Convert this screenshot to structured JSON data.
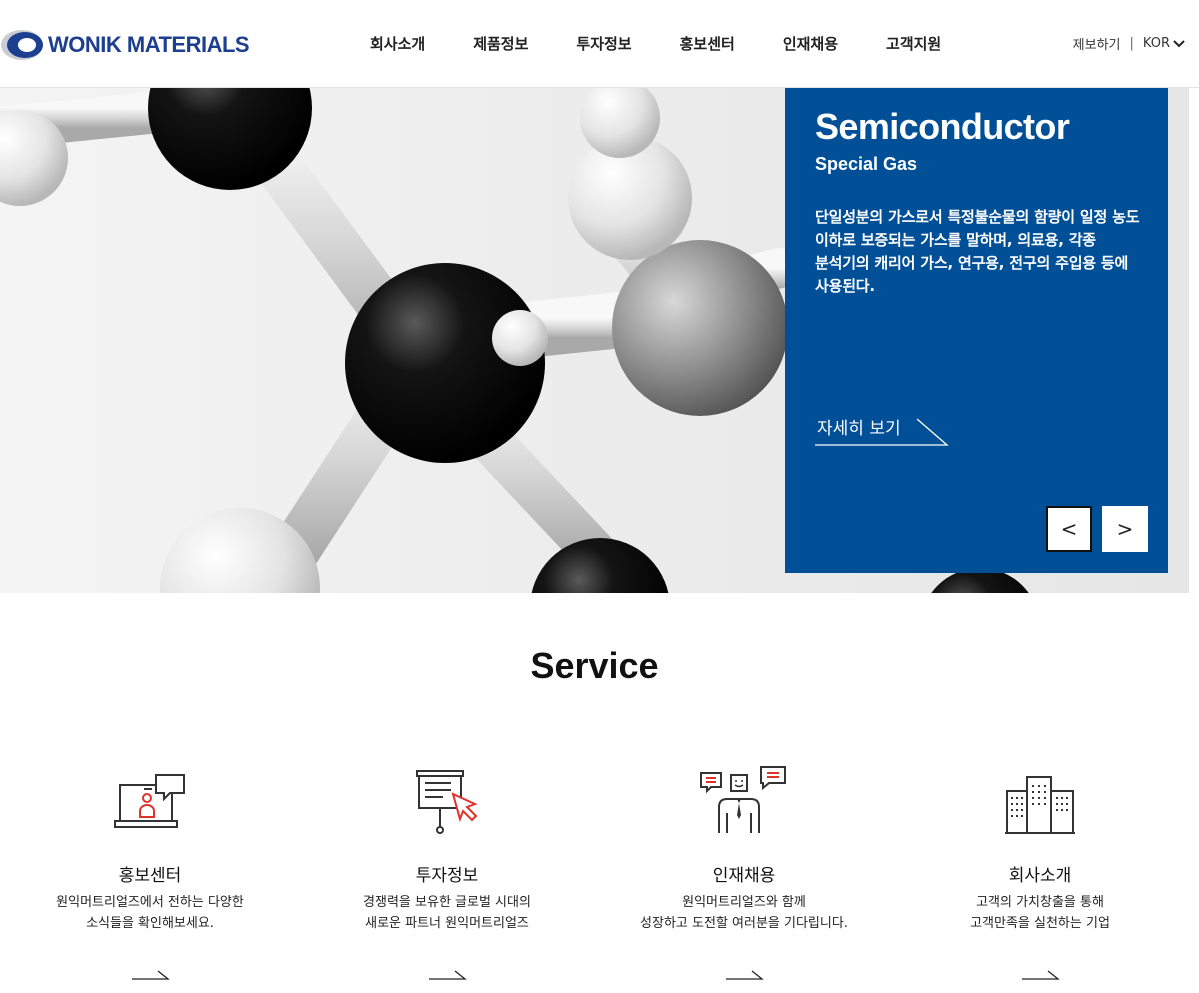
{
  "header": {
    "logo_text": "WONIK MATERIALS",
    "nav": [
      "회사소개",
      "제품정보",
      "투자정보",
      "홍보센터",
      "인재채용",
      "고객지원"
    ],
    "util_report": "제보하기",
    "util_sep": "|",
    "util_lang": "KOR"
  },
  "hero": {
    "title": "Semiconductor",
    "subtitle": "Special Gas",
    "description": "단일성분의 가스로서 특정불순물의 함량이 일정 농도 이하로 보증되는 가스를 말하며, 의료용, 각종 분석기의 캐리어 가스, 연구용, 전구의 주입용 등에 사용된다.",
    "more_label": "자세히 보기",
    "prev_label": "<",
    "next_label": ">"
  },
  "service": {
    "title": "Service",
    "items": [
      {
        "name": "홍보센터",
        "line1": "원익머트리얼즈에서 전하는 다양한",
        "line2": "소식들을 확인해보세요.",
        "icon": "monitor-chat-icon"
      },
      {
        "name": "투자정보",
        "line1": "경쟁력을 보유한 글로벌 시대의",
        "line2": "새로운 파트너 원익머트리얼즈",
        "icon": "presentation-board-icon"
      },
      {
        "name": "인재채용",
        "line1": "원익머트리얼즈와 함께",
        "line2": "성장하고 도전할 여러분을 기다립니다.",
        "icon": "people-talk-icon"
      },
      {
        "name": "회사소개",
        "line1": "고객의 가치창출을 통해",
        "line2": "고객만족을 실천하는 기업",
        "icon": "buildings-icon"
      }
    ]
  },
  "colors": {
    "brand_blue": "#004f97",
    "logo_blue": "#1d3f8f",
    "accent_red": "#e0312b"
  }
}
